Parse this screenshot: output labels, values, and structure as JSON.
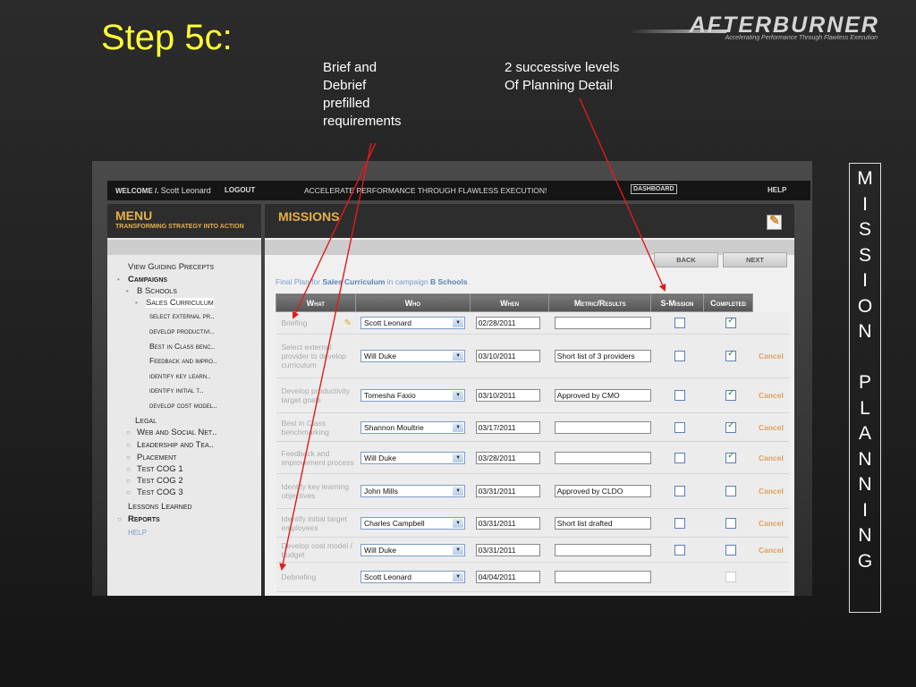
{
  "slide": {
    "title": "Step 5c:",
    "note_left": "Brief and\nDebrief\nprefilled\nrequirements",
    "note_right": "2 successive levels\nOf Planning Detail",
    "vertical_label": [
      "M",
      "I",
      "S",
      "S",
      "I",
      "O",
      "N",
      " ",
      "P",
      "L",
      "A",
      "N",
      "N",
      "I",
      "N",
      "G"
    ]
  },
  "logo": {
    "word": "AFTERBURNER",
    "tagline": "Accelerating Performance Through Flawless Execution"
  },
  "topbar": {
    "welcome": "WELCOME /.",
    "user": "Scott Leonard",
    "logout": "LOGOUT",
    "tagline": "ACCELERATE PERFORMANCE THROUGH FLAWLESS EXECUTION!",
    "dashboard": "DASHBOARD",
    "help": "HELP"
  },
  "menu": {
    "title": "MENU",
    "subtitle": "TRANSFORMING STRATEGY INTO ACTION",
    "items": [
      {
        "label": "View Guiding Precepts"
      },
      {
        "label": "Campaigns"
      },
      {
        "label": "B Schools"
      },
      {
        "label": "Sales Curriculum"
      },
      {
        "label": "select external pr.."
      },
      {
        "label": "develop productivi.."
      },
      {
        "label": "Best in Class benc.."
      },
      {
        "label": "Feedback and impro.."
      },
      {
        "label": "identify key learn.."
      },
      {
        "label": "identify initial t.."
      },
      {
        "label": "develop cost model.."
      },
      {
        "label": "Legal"
      },
      {
        "label": "Web and Social Net.."
      },
      {
        "label": "Leadership and Tea.."
      },
      {
        "label": "Placement"
      },
      {
        "label": "Test COG 1"
      },
      {
        "label": "Test COG 2"
      },
      {
        "label": "Test COG 3"
      },
      {
        "label": "Lessons Learned"
      },
      {
        "label": "Reports"
      },
      {
        "label": "HELP"
      }
    ]
  },
  "missions": {
    "title": "MISSIONS",
    "back": "BACK",
    "next": "NEXT",
    "final_plan_prefix": "Final Plan for",
    "final_plan_item": "Sales Curriculum",
    "final_plan_mid": "in campaign",
    "final_plan_campaign": "B Schools",
    "columns": [
      "What",
      "Who",
      "When",
      "Metric/Results",
      "S-Mission",
      "Completed"
    ],
    "rows": [
      {
        "what": "Briefing",
        "who": "Scott Leonard",
        "when": "02/28/2011",
        "metric": "",
        "smission": false,
        "completed": true,
        "cancel": ""
      },
      {
        "what": "Select external provider to develop curriculum",
        "who": "Will Duke",
        "when": "03/10/2011",
        "metric": "Short list of 3 providers",
        "smission": false,
        "completed": true,
        "cancel": "Cancel"
      },
      {
        "what": "Develop productivity target goals",
        "who": "Tomesha Faxio",
        "when": "03/10/2011",
        "metric": "Approved by CMO",
        "smission": false,
        "completed": true,
        "cancel": "Cancel"
      },
      {
        "what": "Best in Class benchmarking",
        "who": "Shannon Moultrie",
        "when": "03/17/2011",
        "metric": "",
        "smission": false,
        "completed": true,
        "cancel": "Cancel"
      },
      {
        "what": "Feedback and improvement process",
        "who": "Will Duke",
        "when": "03/28/2011",
        "metric": "",
        "smission": false,
        "completed": true,
        "cancel": "Cancel"
      },
      {
        "what": "Identify key learning objectives",
        "who": "John Mills",
        "when": "03/31/2011",
        "metric": "Approved by CLDO",
        "smission": false,
        "completed": false,
        "cancel": "Cancel"
      },
      {
        "what": "Identify initial target employees",
        "who": "Charles Campbell",
        "when": "03/31/2011",
        "metric": "Short list drafted",
        "smission": false,
        "completed": false,
        "cancel": "Cancel"
      },
      {
        "what": "Develop cost model / budget",
        "who": "Will Duke",
        "when": "03/31/2011",
        "metric": "",
        "smission": false,
        "completed": false,
        "cancel": "Cancel"
      },
      {
        "what": "Debriefing",
        "who": "Scott Leonard",
        "when": "04/04/2011",
        "metric": "",
        "smission": null,
        "completed": false,
        "cancel": ""
      }
    ]
  },
  "colors": {
    "title_yellow": "#ffff33",
    "menu_gold": "#e6b04a",
    "arrow_red": "#e21a1a",
    "link_blue": "#7b9bc7"
  }
}
